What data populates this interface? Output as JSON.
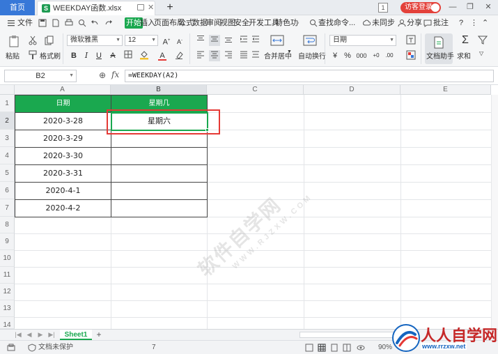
{
  "titlebar": {
    "home_tab": "首页",
    "doc_title": "WEEKDAY函数.xlsx",
    "badge": "1",
    "login": "访客登录"
  },
  "menu": {
    "file": "文件",
    "items": [
      "开始",
      "插入",
      "页面布局",
      "公式",
      "数据",
      "审阅",
      "视图",
      "安全",
      "开发工具",
      "特色功"
    ],
    "search": "查找命令...",
    "sync": "未同步",
    "share": "分享",
    "comment": "批注"
  },
  "ribbon": {
    "paste": "粘贴",
    "format_painter": "格式刷",
    "font_name": "微软雅黑",
    "font_size": "12",
    "merge_center": "合并居中",
    "wrap_text": "自动换行",
    "number_format": "日期",
    "doc_assistant": "文档助手",
    "sum": "求和",
    "percent": "%",
    "thousands": "000"
  },
  "formula_bar": {
    "cell_ref": "B2",
    "fx": "fx",
    "formula": "=WEEKDAY(A2)"
  },
  "grid": {
    "columns": [
      "A",
      "B",
      "C",
      "D",
      "E"
    ],
    "rows": [
      "1",
      "2",
      "3",
      "4",
      "5",
      "6",
      "7",
      "8",
      "9",
      "10",
      "11",
      "12",
      "13",
      "14"
    ],
    "header_a": "日期",
    "header_b": "星期几",
    "dates": [
      "2020-3-28",
      "2020-3-29",
      "2020-3-30",
      "2020-3-31",
      "2020-4-1",
      "2020-4-2"
    ],
    "b2_value": "星期六",
    "watermark": "软件自学网",
    "watermark_url": "WWW.RJZXW.COM"
  },
  "sheets": {
    "active": "Sheet1"
  },
  "status": {
    "protect": "文档未保护",
    "count": "7",
    "zoom": "90%"
  },
  "logo": {
    "name": "人人自学网",
    "url": "www.rrzxw.net"
  },
  "colors": {
    "accent": "#1aa84f",
    "header_fill": "#1aa84f",
    "highlight": "#e53935",
    "home_tab": "#3778d8"
  }
}
